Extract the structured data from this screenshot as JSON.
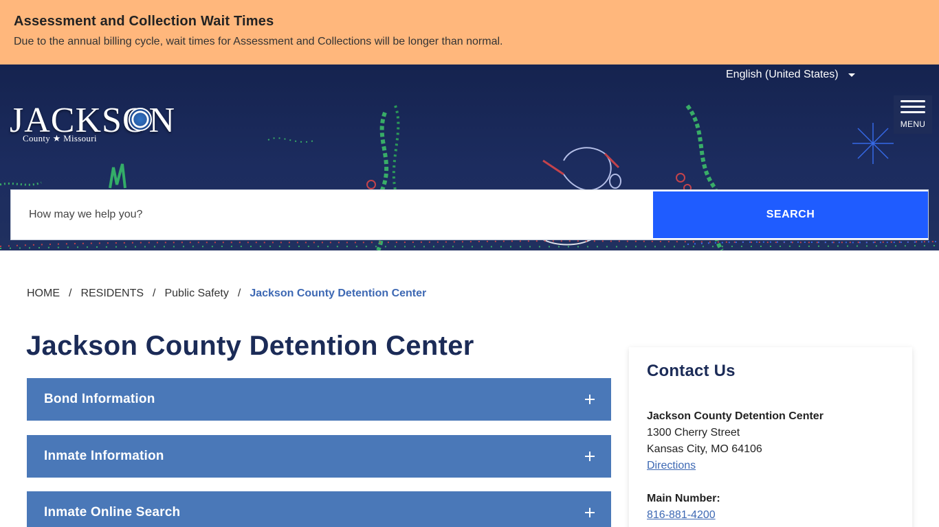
{
  "alert": {
    "title": "Assessment and Collection Wait Times",
    "message": "Due to the annual billing cycle, wait times for Assessment and Collections will be longer than normal."
  },
  "header": {
    "language": "English (United States)",
    "logo": {
      "word": "JACKSON",
      "sub": "County ★ Missouri"
    },
    "menu_label": "MENU"
  },
  "search": {
    "placeholder": "How may we help you?",
    "button_label": "SEARCH"
  },
  "breadcrumb": {
    "items": [
      "HOME",
      "RESIDENTS",
      "Public Safety"
    ],
    "separator": "/",
    "current": "Jackson County Detention Center"
  },
  "main": {
    "title": "Jackson County Detention Center",
    "accordions": [
      {
        "label": "Bond Information"
      },
      {
        "label": "Inmate Information"
      },
      {
        "label": "Inmate Online Search"
      }
    ]
  },
  "contact": {
    "title": "Contact Us",
    "name": "Jackson County Detention Center",
    "street": "1300 Cherry Street",
    "city": "Kansas City, MO 64106",
    "directions_label": "Directions",
    "main_number_label": "Main Number:",
    "main_number": "816-881-4200"
  },
  "colors": {
    "alert_bg": "#ffb77c",
    "hero_bg": "#1c2c5f",
    "search_button": "#1f5cff",
    "accordion_bg": "#4a78b8",
    "title_color": "#1b2b57",
    "link_color": "#3d68b3"
  }
}
